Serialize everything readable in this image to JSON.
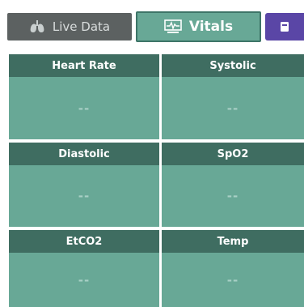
{
  "tabs": {
    "live_data": {
      "label": "Live Data",
      "icon": "lungs-icon"
    },
    "vitals": {
      "label": "Vitals",
      "icon": "monitor-waveform-icon",
      "selected": true
    },
    "extra": {
      "icon": "device-icon"
    }
  },
  "vitals": [
    {
      "label": "Heart Rate",
      "value": "--"
    },
    {
      "label": "Systolic",
      "value": "--"
    },
    {
      "label": "Diastolic",
      "value": "--"
    },
    {
      "label": "SpO2",
      "value": "--"
    },
    {
      "label": "EtCO2",
      "value": "--"
    },
    {
      "label": "Temp",
      "value": "--"
    }
  ],
  "colors": {
    "tile_body": "#68a896",
    "tile_header": "#3f6d61",
    "tab_inactive": "#5c6161",
    "tab_active": "#68a896",
    "tab_extra": "#5a46a6"
  }
}
